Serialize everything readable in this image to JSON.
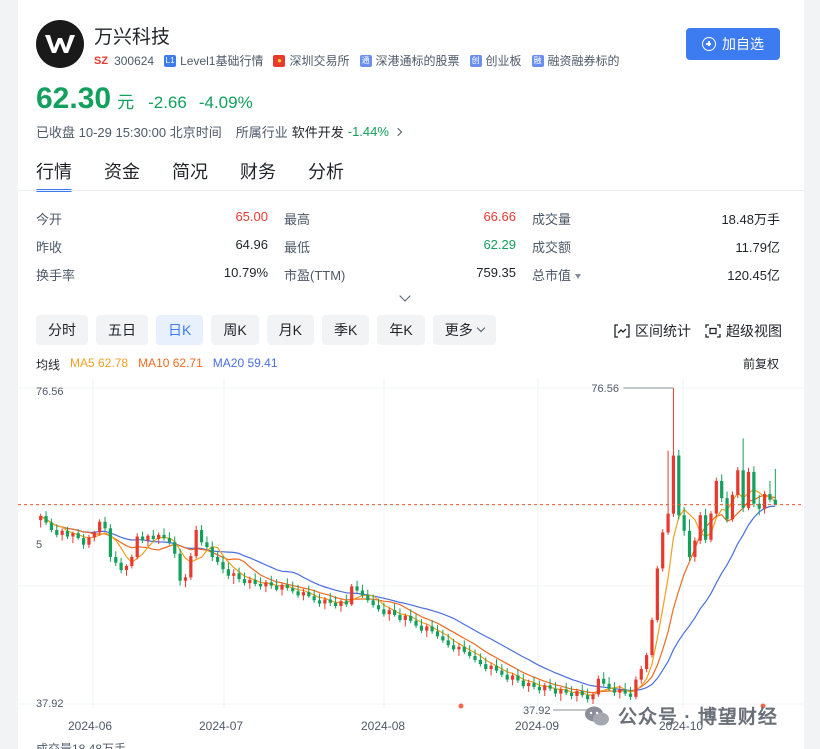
{
  "stock": {
    "name": "万兴科技",
    "market_badge": "SZ",
    "code": "300624",
    "tags": [
      {
        "mark": "L1",
        "label": "Level1基础行情",
        "color": "#3d7bf0"
      },
      {
        "mark": "●",
        "label": "深圳交易所",
        "color": "#e8392e"
      },
      {
        "mark": "通",
        "label": "深港通标的股票",
        "color": "#6c8ef0"
      },
      {
        "mark": "创",
        "label": "创业板",
        "color": "#6c8ef0"
      },
      {
        "mark": "融",
        "label": "融资融券标的",
        "color": "#6c8ef0"
      }
    ],
    "add_button": "加自选"
  },
  "price": {
    "value": "62.30",
    "unit": "元",
    "change": "-2.66",
    "change_pct": "-4.09%",
    "color": "#12a05c"
  },
  "status": {
    "text": "已收盘 10-29 15:30:00 北京时间",
    "industry_label": "所属行业",
    "industry_name": "软件开发",
    "industry_pct": "-1.44%"
  },
  "tabs": [
    {
      "label": "行情",
      "active": true
    },
    {
      "label": "资金",
      "active": false
    },
    {
      "label": "简况",
      "active": false
    },
    {
      "label": "财务",
      "active": false
    },
    {
      "label": "分析",
      "active": false
    }
  ],
  "quote": [
    [
      {
        "label": "今开",
        "value": "65.00",
        "dir": "up"
      },
      {
        "label": "最高",
        "value": "66.66",
        "dir": "up"
      },
      {
        "label": "成交量",
        "value": "18.48万手",
        "dir": ""
      }
    ],
    [
      {
        "label": "昨收",
        "value": "64.96",
        "dir": ""
      },
      {
        "label": "最低",
        "value": "62.29",
        "dir": "down"
      },
      {
        "label": "成交额",
        "value": "11.79亿",
        "dir": ""
      }
    ],
    [
      {
        "label": "换手率",
        "value": "10.79%",
        "dir": ""
      },
      {
        "label": "市盈(TTM)",
        "value": "759.35",
        "dir": ""
      },
      {
        "label": "总市值",
        "value": "120.45亿",
        "dir": ""
      }
    ]
  ],
  "periods": [
    {
      "label": "分时",
      "active": false
    },
    {
      "label": "五日",
      "active": false
    },
    {
      "label": "日K",
      "active": true
    },
    {
      "label": "周K",
      "active": false
    },
    {
      "label": "月K",
      "active": false
    },
    {
      "label": "季K",
      "active": false
    },
    {
      "label": "年K",
      "active": false
    },
    {
      "label": "更多",
      "active": false,
      "dropdown": true
    }
  ],
  "tools": {
    "range_stat": "区间统计",
    "super_view": "超级视图"
  },
  "ma": {
    "label": "均线",
    "ma5": "MA5 62.78",
    "ma10": "MA10 62.71",
    "ma20": "MA20 59.41",
    "ma5_color": "#f0a020",
    "ma10_color": "#f06a20",
    "ma20_color": "#4a6ee0"
  },
  "restore": "前复权",
  "chart_data": {
    "type": "candlestick",
    "y_top_label": "76.56",
    "y_bottom_label": "37.92",
    "y_mid_label": "5",
    "high_marker": "76.56",
    "low_marker": "37.92",
    "ylim": [
      37.92,
      76.56
    ],
    "x_ticks": [
      "2024-06",
      "2024-07",
      "2024-08",
      "2024-09",
      "2024-10"
    ],
    "last_close": 62.3,
    "up_color": "#e8392e",
    "down_color": "#12a05c",
    "candles": [
      [
        60.4,
        61.2,
        59.5,
        60.9
      ],
      [
        60.9,
        61.5,
        59.8,
        60.1
      ],
      [
        60.1,
        60.6,
        58.9,
        59.2
      ],
      [
        59.2,
        59.9,
        58.3,
        58.6
      ],
      [
        58.6,
        59.4,
        57.9,
        59.1
      ],
      [
        59.1,
        59.6,
        58.1,
        58.4
      ],
      [
        58.4,
        59.0,
        57.6,
        58.8
      ],
      [
        58.8,
        59.3,
        58.0,
        58.2
      ],
      [
        58.2,
        58.7,
        56.9,
        57.4
      ],
      [
        57.4,
        58.6,
        57.0,
        58.3
      ],
      [
        58.3,
        59.1,
        57.8,
        58.9
      ],
      [
        58.9,
        60.5,
        58.5,
        60.2
      ],
      [
        60.2,
        60.8,
        59.1,
        59.4
      ],
      [
        59.4,
        59.9,
        55.3,
        55.9
      ],
      [
        55.9,
        56.6,
        54.8,
        55.2
      ],
      [
        55.2,
        55.8,
        53.9,
        54.3
      ],
      [
        54.3,
        55.0,
        53.6,
        54.8
      ],
      [
        54.8,
        56.2,
        54.5,
        55.9
      ],
      [
        55.9,
        58.8,
        55.6,
        58.4
      ],
      [
        58.4,
        59.0,
        57.6,
        57.9
      ],
      [
        57.9,
        58.7,
        57.2,
        58.5
      ],
      [
        58.5,
        59.2,
        57.8,
        58.1
      ],
      [
        58.1,
        58.9,
        57.5,
        58.6
      ],
      [
        58.6,
        59.4,
        57.9,
        58.2
      ],
      [
        58.2,
        58.9,
        57.4,
        57.7
      ],
      [
        57.7,
        58.4,
        55.8,
        56.3
      ],
      [
        56.3,
        56.9,
        52.4,
        53.0
      ],
      [
        53.0,
        53.8,
        52.2,
        53.4
      ],
      [
        53.4,
        56.4,
        53.1,
        56.0
      ],
      [
        56.0,
        59.7,
        55.7,
        59.2
      ],
      [
        59.2,
        59.8,
        57.3,
        57.7
      ],
      [
        57.7,
        58.4,
        56.8,
        57.1
      ],
      [
        57.1,
        57.8,
        55.4,
        55.9
      ],
      [
        55.9,
        56.6,
        54.9,
        55.3
      ],
      [
        55.3,
        56.0,
        53.9,
        54.4
      ],
      [
        54.4,
        55.2,
        53.2,
        53.6
      ],
      [
        53.6,
        54.4,
        52.6,
        53.9
      ],
      [
        53.9,
        54.6,
        52.8,
        53.2
      ],
      [
        53.2,
        54.0,
        52.4,
        52.7
      ],
      [
        52.7,
        53.5,
        52.0,
        53.1
      ],
      [
        53.1,
        53.9,
        52.3,
        52.6
      ],
      [
        52.6,
        53.4,
        51.9,
        52.3
      ],
      [
        52.3,
        53.1,
        51.6,
        52.8
      ],
      [
        52.8,
        53.6,
        52.0,
        52.4
      ],
      [
        52.4,
        53.2,
        51.7,
        51.9
      ],
      [
        51.9,
        52.7,
        51.2,
        52.5
      ],
      [
        52.5,
        53.3,
        51.8,
        52.1
      ],
      [
        52.1,
        52.9,
        51.4,
        51.7
      ],
      [
        51.7,
        52.5,
        50.9,
        51.2
      ],
      [
        51.2,
        52.0,
        50.6,
        51.6
      ],
      [
        51.6,
        52.4,
        50.9,
        51.1
      ],
      [
        51.1,
        51.9,
        50.3,
        50.6
      ],
      [
        50.6,
        51.4,
        49.8,
        50.2
      ],
      [
        50.2,
        51.0,
        49.5,
        50.7
      ],
      [
        50.7,
        51.5,
        49.9,
        50.3
      ],
      [
        50.3,
        51.1,
        49.6,
        49.9
      ],
      [
        49.9,
        50.7,
        49.2,
        50.5
      ],
      [
        50.5,
        51.3,
        49.8,
        50.1
      ],
      [
        50.1,
        52.6,
        49.9,
        52.3
      ],
      [
        52.3,
        53.0,
        51.5,
        51.8
      ],
      [
        51.8,
        52.5,
        50.9,
        51.2
      ],
      [
        51.2,
        51.9,
        50.3,
        50.6
      ],
      [
        50.6,
        51.3,
        49.7,
        50.0
      ],
      [
        50.0,
        50.8,
        49.2,
        49.5
      ],
      [
        49.5,
        50.3,
        48.6,
        48.9
      ],
      [
        48.9,
        49.7,
        48.1,
        49.4
      ],
      [
        49.4,
        50.2,
        48.6,
        48.8
      ],
      [
        48.8,
        49.6,
        47.9,
        48.2
      ],
      [
        48.2,
        49.0,
        47.4,
        48.7
      ],
      [
        48.7,
        49.5,
        47.8,
        48.1
      ],
      [
        48.1,
        48.9,
        47.2,
        47.5
      ],
      [
        47.5,
        48.3,
        46.6,
        46.9
      ],
      [
        46.9,
        47.7,
        46.1,
        47.4
      ],
      [
        47.4,
        48.2,
        46.5,
        46.8
      ],
      [
        46.8,
        47.6,
        45.9,
        46.2
      ],
      [
        46.2,
        47.0,
        45.4,
        45.7
      ],
      [
        45.7,
        46.5,
        44.8,
        45.1
      ],
      [
        45.1,
        45.9,
        44.3,
        44.6
      ],
      [
        44.6,
        45.4,
        43.8,
        44.9
      ],
      [
        44.9,
        45.7,
        44.0,
        44.3
      ],
      [
        44.3,
        45.1,
        43.5,
        43.8
      ],
      [
        43.8,
        44.6,
        43.0,
        43.3
      ],
      [
        43.3,
        44.1,
        42.5,
        42.8
      ],
      [
        42.8,
        43.6,
        41.9,
        42.2
      ],
      [
        42.2,
        43.0,
        41.4,
        42.6
      ],
      [
        42.6,
        43.4,
        41.7,
        42.0
      ],
      [
        42.0,
        42.8,
        41.2,
        41.5
      ],
      [
        41.5,
        42.3,
        40.6,
        40.9
      ],
      [
        40.9,
        41.7,
        40.2,
        41.4
      ],
      [
        41.4,
        42.2,
        40.5,
        40.8
      ],
      [
        40.8,
        41.6,
        39.8,
        40.1
      ],
      [
        40.1,
        40.9,
        39.4,
        40.5
      ],
      [
        40.5,
        41.3,
        39.7,
        40.0
      ],
      [
        40.0,
        40.8,
        39.2,
        39.6
      ],
      [
        39.6,
        40.5,
        38.9,
        40.2
      ],
      [
        40.2,
        41.0,
        39.5,
        39.8
      ],
      [
        39.8,
        40.6,
        38.8,
        39.2
      ],
      [
        39.2,
        40.0,
        38.3,
        39.7
      ],
      [
        39.7,
        40.5,
        39.0,
        39.3
      ],
      [
        39.3,
        40.1,
        38.5,
        38.9
      ],
      [
        38.9,
        39.8,
        38.2,
        39.5
      ],
      [
        39.5,
        40.3,
        38.7,
        39.0
      ],
      [
        39.0,
        39.8,
        38.1,
        38.5
      ],
      [
        38.5,
        39.3,
        37.92,
        39.1
      ],
      [
        39.1,
        41.4,
        38.8,
        41.0
      ],
      [
        41.0,
        41.8,
        40.1,
        40.4
      ],
      [
        40.4,
        41.2,
        39.5,
        39.8
      ],
      [
        39.8,
        40.6,
        38.9,
        39.3
      ],
      [
        39.3,
        40.2,
        38.6,
        39.7
      ],
      [
        39.7,
        40.5,
        38.9,
        39.2
      ],
      [
        39.2,
        40.0,
        38.4,
        38.8
      ],
      [
        38.8,
        41.3,
        38.5,
        40.9
      ],
      [
        40.9,
        42.6,
        40.4,
        42.2
      ],
      [
        42.2,
        44.2,
        41.8,
        43.9
      ],
      [
        43.9,
        48.5,
        43.6,
        48.2
      ],
      [
        48.2,
        54.8,
        47.9,
        54.5
      ],
      [
        54.5,
        59.3,
        54.1,
        58.9
      ],
      [
        58.9,
        68.9,
        58.6,
        61.2
      ],
      [
        61.2,
        76.56,
        60.8,
        68.3
      ],
      [
        68.3,
        69.0,
        60.5,
        61.0
      ],
      [
        61.0,
        62.0,
        58.5,
        59.1
      ],
      [
        59.1,
        60.5,
        55.4,
        55.9
      ],
      [
        55.9,
        58.3,
        55.3,
        57.9
      ],
      [
        57.9,
        61.4,
        57.5,
        61.0
      ],
      [
        61.0,
        61.8,
        57.6,
        58.0
      ],
      [
        58.0,
        61.5,
        57.7,
        61.2
      ],
      [
        61.2,
        65.6,
        60.8,
        65.2
      ],
      [
        65.2,
        66.0,
        62.6,
        63.1
      ],
      [
        63.1,
        63.9,
        60.1,
        60.5
      ],
      [
        60.5,
        63.9,
        60.2,
        63.5
      ],
      [
        63.5,
        66.9,
        63.1,
        66.5
      ],
      [
        66.5,
        70.4,
        61.4,
        61.9
      ],
      [
        61.9,
        66.8,
        61.6,
        66.3
      ],
      [
        66.3,
        67.0,
        62.0,
        62.4
      ],
      [
        62.4,
        63.5,
        61.0,
        61.8
      ],
      [
        61.8,
        64.0,
        61.2,
        63.6
      ],
      [
        63.6,
        65.2,
        62.6,
        62.9
      ],
      [
        62.9,
        66.66,
        62.29,
        62.3
      ]
    ]
  },
  "watermark": "公众号 · 博望财经",
  "volume_label": "成交量18.48万手"
}
